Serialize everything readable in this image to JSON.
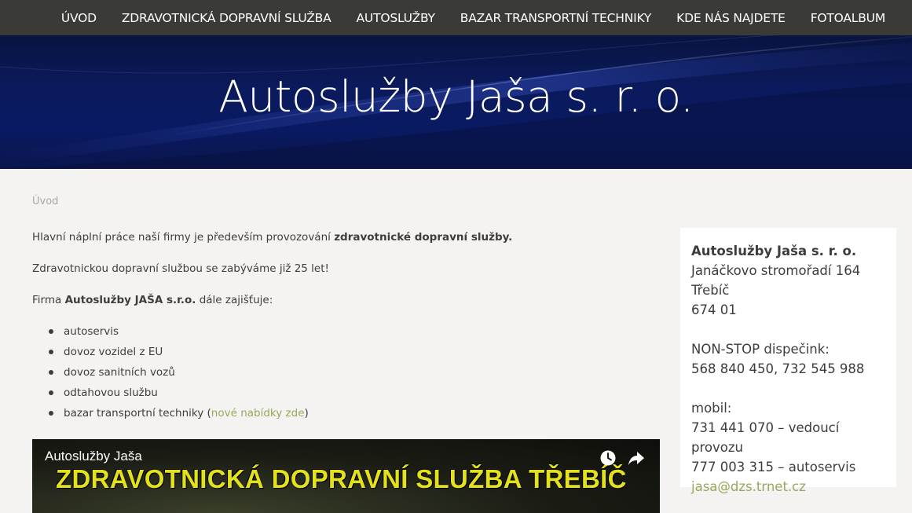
{
  "nav": {
    "items": [
      {
        "id": "uvod",
        "label": "ÚVOD"
      },
      {
        "id": "zdravotnicka",
        "label": "ZDRAVOTNICKÁ DOPRAVNÍ SLUŽBA"
      },
      {
        "id": "autosluzby",
        "label": "AUTOSLUŽBY"
      },
      {
        "id": "bazar",
        "label": "BAZAR TRANSPORTNÍ TECHNIKY"
      },
      {
        "id": "kde",
        "label": "KDE NÁS NAJDETE"
      },
      {
        "id": "fotoalbum",
        "label": "FOTOALBUM"
      }
    ]
  },
  "hero": {
    "title": "Autoslužby Jaša s. r. o."
  },
  "breadcrumb": "Úvod",
  "main": {
    "p1_text": "Hlavní náplní práce naší firmy je především provozování ",
    "p1_bold": "zdravotnické dopravní služby.",
    "p2": "Zdravotnickou dopravní službou se zabýváme již 25 let!",
    "p3_pre": "Firma ",
    "p3_bold": "Autoslužby JAŠA s.r.o.",
    "p3_post": " dále zajišťuje:",
    "services": [
      "autoservis",
      "dovoz vozidel z EU",
      "dovoz sanitních vozů",
      "odtahovou službu"
    ],
    "last_service_pre": "bazar transportní techniky (",
    "last_service_link": "nové nabídky zde",
    "last_service_post": ")"
  },
  "video": {
    "title": "Autoslužby Jaša",
    "banner": "ZDRAVOTNICKÁ DOPRAVNÍ SLUŽBA TŘEBÍČ",
    "icons": [
      "watch-later-icon",
      "share-icon"
    ]
  },
  "contact": {
    "company": "Autoslužby Jaša s. r. o.",
    "street": "Janáčkovo stromořadí 164",
    "city": "Třebíč",
    "zip": "674 01",
    "dispatch_label": "NON-STOP dispečink:",
    "dispatch_phones": "568 840 450, 732 545 988",
    "mobile_label": "mobil:",
    "mobile_1": "731 441 070 – vedoucí provozu",
    "mobile_2": "777 003 315 – autoservis",
    "email": "jasa@dzs.trnet.cz"
  },
  "colors": {
    "nav_bg": "#3a3b36",
    "hero_bg": "#0b1a5c",
    "page_bg": "#f4f3f1",
    "link": "#98a85a",
    "banner_text": "#e3e11c"
  }
}
